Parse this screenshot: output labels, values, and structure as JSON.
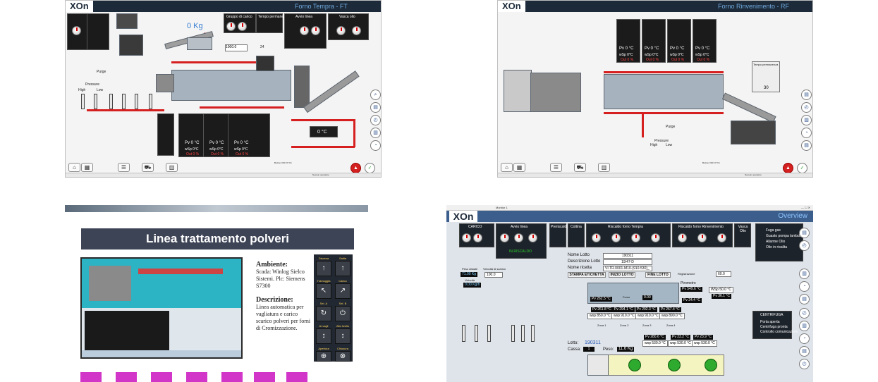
{
  "forno_tempra": {
    "logo": "XOn",
    "title": "Forno Tempra - FT",
    "weight_display": "0 Kg",
    "percent_display": "0 %",
    "pv_value": "Pv 0 °C",
    "wsp_value": "wSp 0°C",
    "out_value": "Out 0 %",
    "gas_temp": "0 °C",
    "setpoint_value": "1000.0",
    "tempo_value": "24",
    "purge_label": "Purge",
    "pressure_label": "Pressure",
    "high_label": "High",
    "low_label": "Low",
    "sections": [
      "Gruppo di carico",
      "Tempo permanenza",
      "Avvio linea",
      "Vasca olio"
    ],
    "footer_text": "Buzzer OFF 07 hh",
    "operator_text": "Nessun operatore"
  },
  "forno_rinvenimento": {
    "logo": "XOn",
    "title": "Forno Rinvenimento - RF",
    "pv_value": "Pv 0 °C",
    "wsp_value": "wSp 0°C",
    "out_value": "Out 0 %",
    "tempo_value": "30",
    "tempo_label": "Tempo permanenza",
    "purge_label": "Purge",
    "pressure_label": "Pressure",
    "high_label": "High",
    "low_label": "Low",
    "footer_text": "Buzzer OFF 07 hh",
    "operator_text": "Nessun operatore"
  },
  "linea_polveri": {
    "title": "Linea trattamento polveri",
    "ambiente_heading": "Ambiente:",
    "ambiente_text": "Scada: Winlog Sielco Sistemi. Plc: Siemens S7300",
    "descrizione_heading": "Descrizione:",
    "descrizione_text": "Linea automatica per vagliatura e carico scarico polveri per forni di Cromizzazione.",
    "keypad_labels": [
      "Discesa",
      "Salita",
      "Tramoggia",
      "Carico",
      "Sel. A",
      "Sel. B",
      "Al vagli",
      "Alto livello",
      "Apertura",
      "Chiusura"
    ],
    "keypad_glyphs": [
      "↑",
      "↑",
      "↖",
      "↗",
      "↻",
      "⏻",
      "↕",
      "↕",
      "⊕",
      "⊗"
    ]
  },
  "overview": {
    "logo": "XOn",
    "title": "Overview",
    "window_title": "Monitor 1",
    "sections": [
      "CARICO",
      "Avvio linea",
      "Preriscaldo",
      "Cottina",
      "Riscaldo forno Tempra",
      "Riscaldo forno Rinvenimento",
      "Vasca Olio"
    ],
    "in_riscaldo": "IN RISCALDO",
    "nome_lotto_label": "Nome Lotto",
    "nome_lotto_value": "190311",
    "descr_lotto_label": "Descrizione Lotto",
    "descr_lotto_value": "19/47-D",
    "nome_ricetta_label": "Nome ricetta",
    "nome_ricetta_value": "VI.TR.0001-M10-(910-530)_",
    "btn_stampa": "STAMPA ETICHETTA",
    "btn_inizio": "INIZIO LOTTO",
    "btn_fine": "FINE LOTTO",
    "peso_attuale_label": "Peso attuale",
    "peso_attuale_value": "71.00 Kg",
    "velocita_scarico_label": "Velocità di scarico",
    "velocita_scarico_value": "100.0",
    "velocita_label": "Velocità",
    "velocita_value": "0.00 Kg/h",
    "registrazione_label": "Registrazione",
    "registrazione_value": "60.0",
    "lotto_label": "Lotto:",
    "lotto_value": "190311",
    "cassa_label": "Cassa:",
    "cassa_value": "1",
    "peso_label": "Peso:",
    "peso_value": "11.6 Kg",
    "zone_pv": [
      "Pv 261.8 °C",
      "Pv 294.1 °C",
      "Pv 292.3 °C",
      "Pv 267.4 °C"
    ],
    "zone_wsp": [
      "wsp 850.0 °C",
      "wsp 910.0 °C",
      "wsp 910.0 °C",
      "wsp 890.0 °C"
    ],
    "zone_names": [
      "Zona 1",
      "Zona 2",
      "Zona 3",
      "Zona 4"
    ],
    "rinv_pv": [
      "Pv 280.6 °C",
      "Pv 23.2 °C",
      "Pv 23.9 °C"
    ],
    "rinv_wsp": [
      "wsp 530.0 °C",
      "wsp 530.0 °C",
      "wsp 530.0 °C"
    ],
    "pirometro_label": "Pirometro",
    "pirometro_value": "Pv 549.6 °C",
    "vasca_olio_wsp": "WSp 50.0 °C",
    "vasca_olio_pv": "Pv 36.1 °C",
    "anti_incendio_value": "Pv 24.4 °C",
    "tc2_value": "Pv 262.5 °C",
    "fumo_value": "0.00",
    "fumo_label": "Fumo",
    "right_panel": [
      "Fuga gas",
      "Guasto pompa lambda",
      "Allarme Olio",
      "Olio in risalita"
    ],
    "centrifuga_label": "CENTRIFUGA",
    "centrifuga_items": [
      "Porta aperta",
      "Centrifuga pronta",
      "Controllo comunicazioni"
    ]
  }
}
